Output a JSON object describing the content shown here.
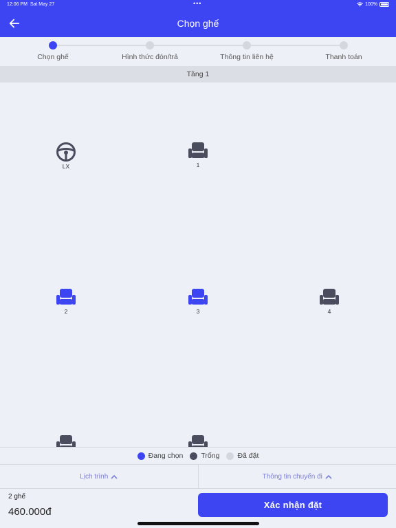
{
  "status_bar": {
    "time": "12:06 PM",
    "date": "Sat May 27",
    "battery": "100%"
  },
  "header": {
    "title": "Chọn ghế",
    "back_icon": "arrow-left-icon"
  },
  "stepper": {
    "steps": [
      {
        "label": "Chọn ghế",
        "active": true
      },
      {
        "label": "Hình thức đón/trả",
        "active": false
      },
      {
        "label": "Thông tin liên hệ",
        "active": false
      },
      {
        "label": "Thanh toán",
        "active": false
      }
    ]
  },
  "floor": {
    "label": "Tầng 1"
  },
  "seats": {
    "driver": {
      "label": "LX",
      "icon": "steering-wheel-icon"
    },
    "s1": {
      "label": "1",
      "status": "empty"
    },
    "s2": {
      "label": "2",
      "status": "selected"
    },
    "s3": {
      "label": "3",
      "status": "selected"
    },
    "s4": {
      "label": "4",
      "status": "empty"
    }
  },
  "legend": {
    "selected": {
      "label": "Đang chọn",
      "color": "#3d44f2"
    },
    "empty": {
      "label": "Trống",
      "color": "#4a4d5e"
    },
    "booked": {
      "label": "Đã đặt",
      "color": "#d5d7df"
    }
  },
  "info": {
    "schedule": "Lịch trình",
    "trip_info": "Thông tin chuyến đi"
  },
  "summary": {
    "count": "2 ghế",
    "price": "460.000đ"
  },
  "confirm_label": "Xác nhận đặt"
}
